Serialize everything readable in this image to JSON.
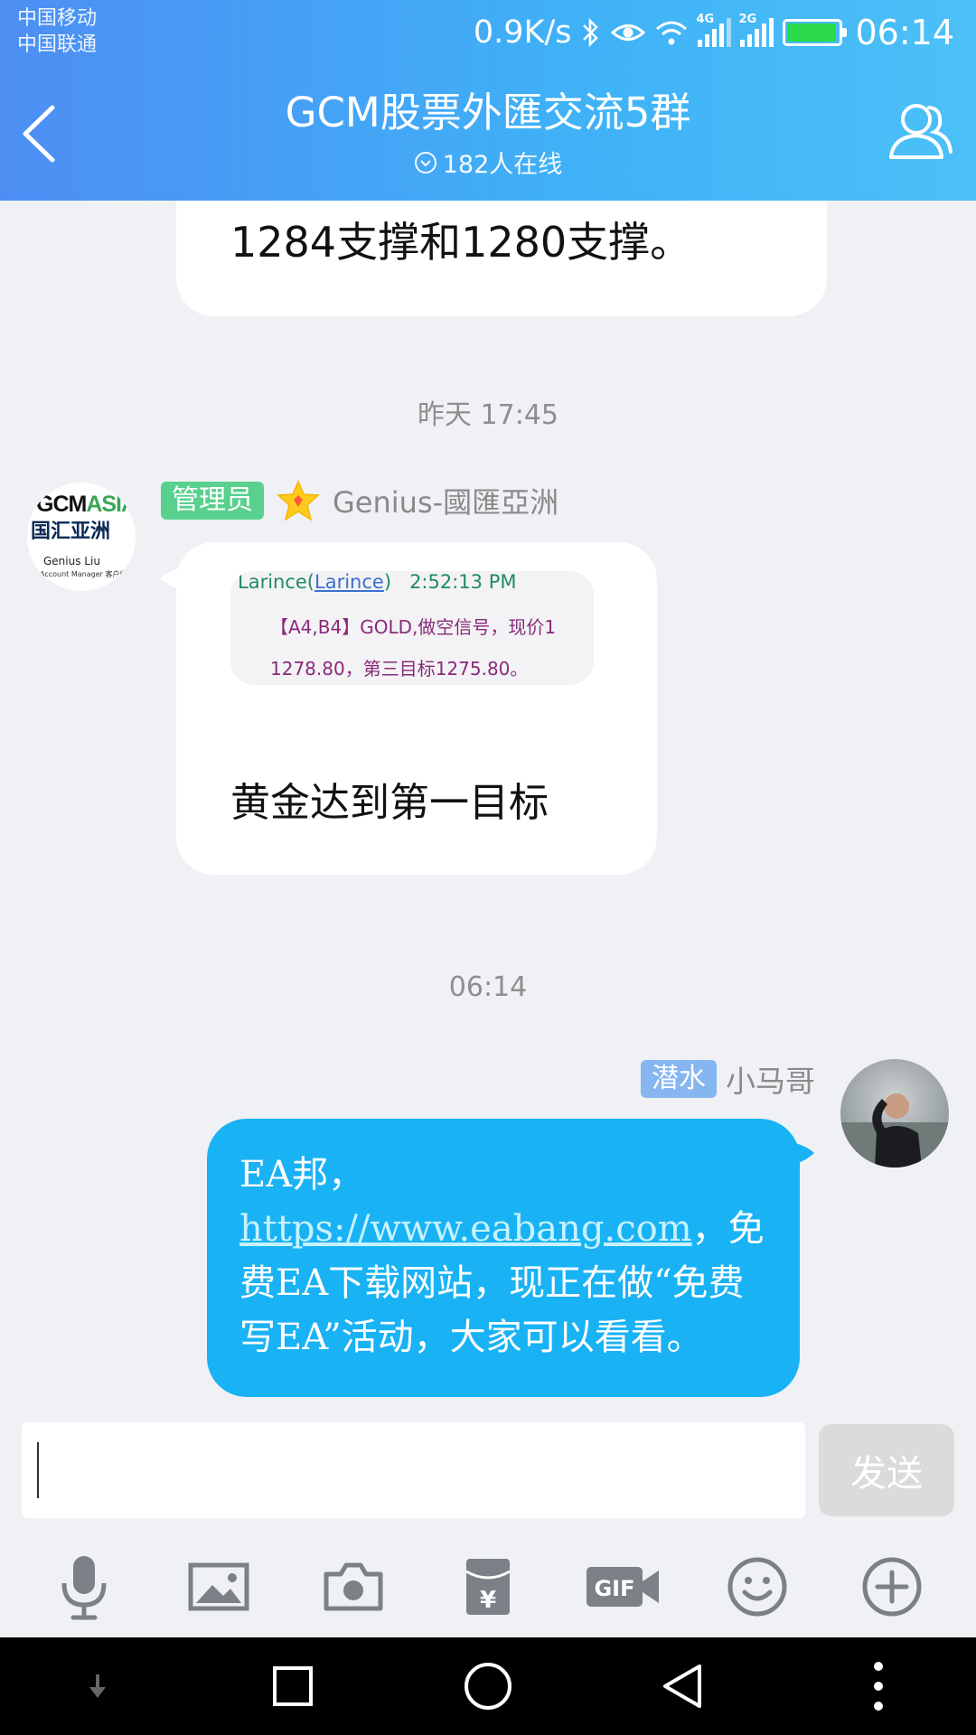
{
  "status_bar": {
    "carrier_1": "中国移动",
    "carrier_2": "中国联通",
    "net_speed": "0.9K/s",
    "signal_1_label": "4G",
    "signal_2_label": "2G",
    "battery_level": 0.95,
    "time": "06:14"
  },
  "header": {
    "title": "GCM股票外匯交流5群",
    "online": "182人在线"
  },
  "messages": {
    "previous_text": "1284支撑和1280支撑。",
    "time_1": "昨天 17:45",
    "admin": {
      "avatar_logo_text_1": "GCM",
      "avatar_logo_text_2": "ASIA",
      "avatar_logo_cn": "国汇亚洲",
      "avatar_logo_name": "Genius Liu",
      "avatar_logo_sub": "Account Manager 客户经理",
      "role_tag": "管理员",
      "sender": "Genius-國匯亞洲",
      "quote": {
        "author_a": "Larince(",
        "author_link": "Larince",
        "author_b": ")",
        "time": "2:52:13 PM",
        "line_2": "【A4,B4】GOLD,做空信号，现价1",
        "line_3": "1278.80，第三目标1275.80。"
      },
      "text": "黄金达到第一目标"
    },
    "time_2": "06:14",
    "me": {
      "role_tag": "潜水",
      "sender": "小马哥",
      "text_a": "EA邦，",
      "link": "https://www.eabang.com",
      "text_b": "，免费EA下载网站，现正在做“免费写EA”活动，大家可以看看。"
    }
  },
  "input": {
    "value": "",
    "send_label": "发送"
  },
  "toolbar": [
    "mic-icon",
    "image-icon",
    "camera-icon",
    "red-packet-icon",
    "gif-icon",
    "emoji-icon",
    "plus-icon"
  ],
  "navbar": [
    "down-arrow-icon",
    "recents-icon",
    "home-icon",
    "back-icon",
    "more-icon"
  ]
}
